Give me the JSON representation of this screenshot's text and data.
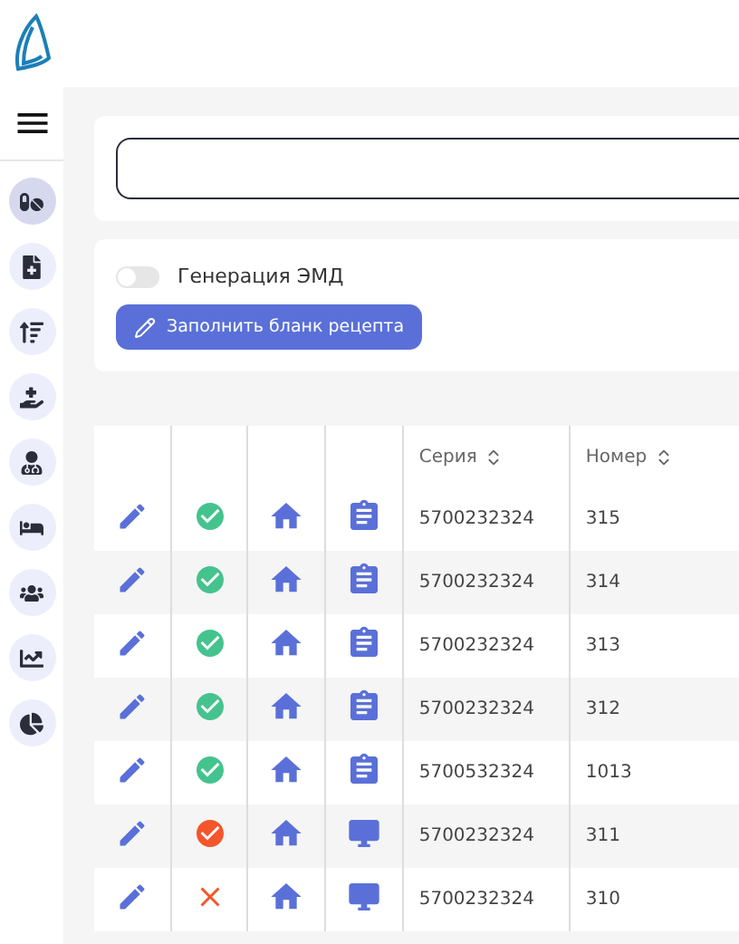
{
  "sidebar": {
    "items": [
      {
        "kind": "pills",
        "selected": true
      },
      {
        "kind": "file",
        "selected": false
      },
      {
        "kind": "sort",
        "selected": false
      },
      {
        "kind": "hand",
        "selected": false
      },
      {
        "kind": "doctor",
        "selected": false
      },
      {
        "kind": "bed",
        "selected": false
      },
      {
        "kind": "users",
        "selected": false
      },
      {
        "kind": "chart",
        "selected": false
      },
      {
        "kind": "pie",
        "selected": false
      }
    ]
  },
  "emd_toggle": {
    "label": "Генерация ЭМД",
    "on": false
  },
  "fill_button": {
    "label": "Заполнить бланк рецепта"
  },
  "table": {
    "columns": [
      "Серия",
      "Номер"
    ],
    "rows": [
      {
        "status_icon": {
          "kind": "ok"
        },
        "doc_icon": {
          "kind": "clipboard"
        },
        "series": "5700232324",
        "number": "315"
      },
      {
        "status_icon": {
          "kind": "ok"
        },
        "doc_icon": {
          "kind": "clipboard"
        },
        "series": "5700232324",
        "number": "314"
      },
      {
        "status_icon": {
          "kind": "ok"
        },
        "doc_icon": {
          "kind": "clipboard"
        },
        "series": "5700232324",
        "number": "313"
      },
      {
        "status_icon": {
          "kind": "ok"
        },
        "doc_icon": {
          "kind": "clipboard"
        },
        "series": "5700232324",
        "number": "312"
      },
      {
        "status_icon": {
          "kind": "ok"
        },
        "doc_icon": {
          "kind": "clipboard"
        },
        "series": "5700532324",
        "number": "1013"
      },
      {
        "status_icon": {
          "kind": "warning"
        },
        "doc_icon": {
          "kind": "monitor"
        },
        "series": "5700232324",
        "number": "311"
      },
      {
        "status_icon": {
          "kind": "error"
        },
        "doc_icon": {
          "kind": "monitor"
        },
        "series": "5700232324",
        "number": "310"
      }
    ]
  }
}
